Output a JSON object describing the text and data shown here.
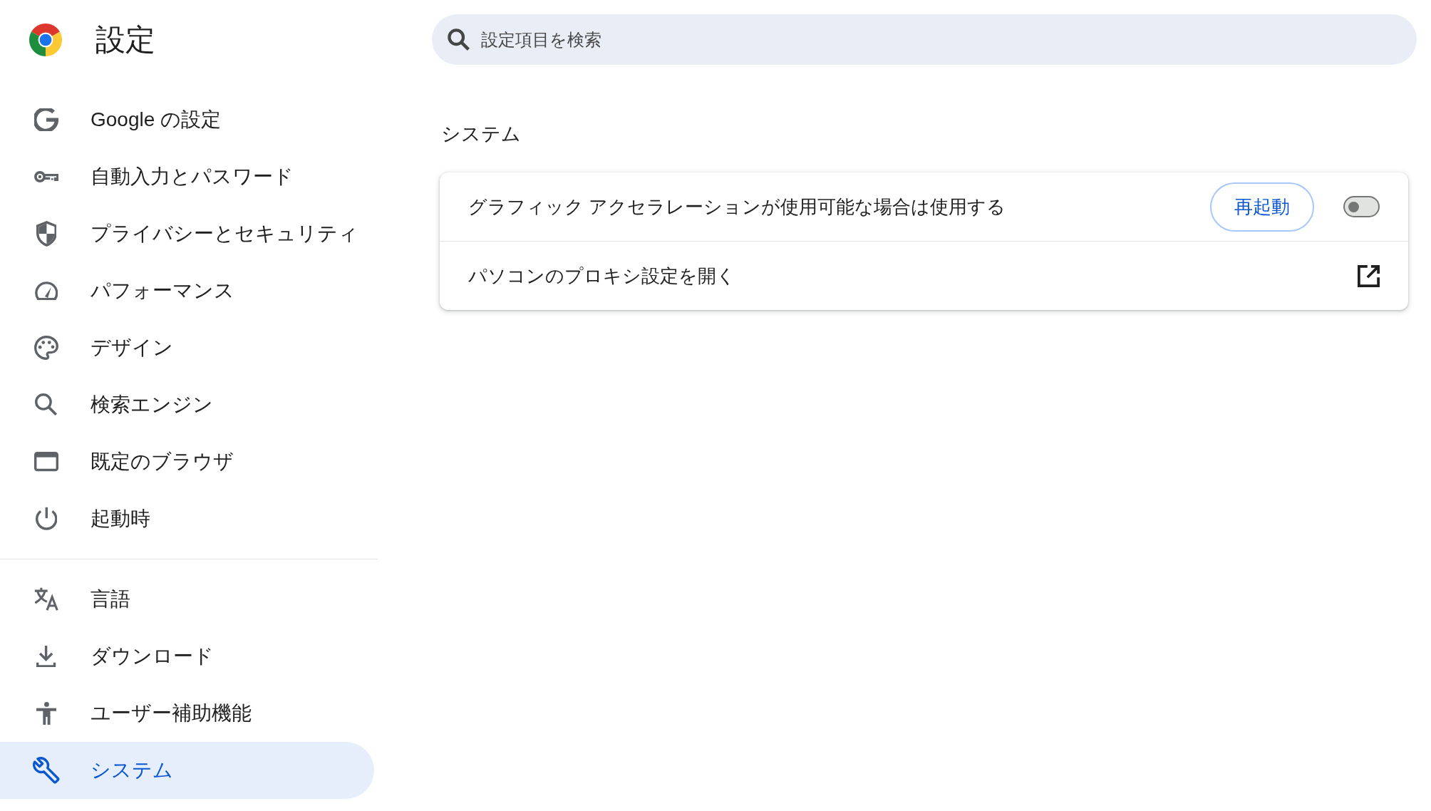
{
  "header": {
    "title": "設定"
  },
  "search": {
    "placeholder": "設定項目を検索"
  },
  "sidebar": {
    "groups": [
      {
        "items": [
          {
            "label": "Google の設定",
            "selected": false
          },
          {
            "label": "自動入力とパスワード",
            "selected": false
          },
          {
            "label": "プライバシーとセキュリティ",
            "selected": false
          },
          {
            "label": "パフォーマンス",
            "selected": false
          },
          {
            "label": "デザイン",
            "selected": false
          },
          {
            "label": "検索エンジン",
            "selected": false
          },
          {
            "label": "既定のブラウザ",
            "selected": false
          },
          {
            "label": "起動時",
            "selected": false
          }
        ]
      },
      {
        "items": [
          {
            "label": "言語",
            "selected": false
          },
          {
            "label": "ダウンロード",
            "selected": false
          },
          {
            "label": "ユーザー補助機能",
            "selected": false
          },
          {
            "label": "システム",
            "selected": true
          }
        ]
      }
    ]
  },
  "section": {
    "title": "システム",
    "rows": [
      {
        "kind": "toggle",
        "label": "グラフィック アクセラレーションが使用可能な場合は使用する",
        "button": "再起動",
        "on": false
      },
      {
        "kind": "link",
        "label": "パソコンのプロキシ設定を開く"
      }
    ]
  }
}
